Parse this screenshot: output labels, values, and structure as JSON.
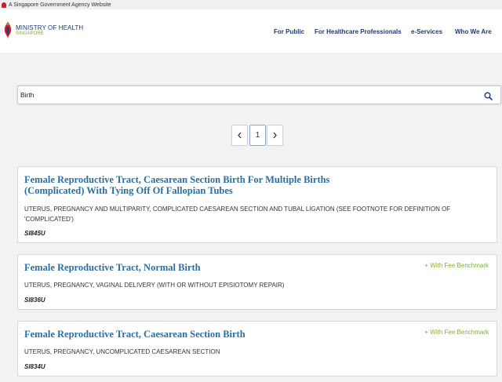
{
  "gov_banner": "A Singapore Government Agency Website",
  "logo": {
    "title": "MINISTRY OF HEALTH",
    "subtitle": "SINGAPORE"
  },
  "nav": {
    "items": [
      "For Public",
      "For Healthcare Professionals",
      "e-Services",
      "Who We Are"
    ]
  },
  "search": {
    "value": "Birth"
  },
  "pagination": {
    "prev": "‹",
    "current": "1",
    "next": "›"
  },
  "results": [
    {
      "title_line1": "Female Reproductive Tract, Caesarean Section Birth For Multiple Births",
      "title_line2": "(Complicated) With Tying Off Of Fallopian Tubes",
      "description_line1": "UTERUS, PREGNANCY AND MULTIPARITY, COMPLICATED CAESAREAN SECTION AND TUBAL LIGATION (SEE FOOTNOTE FOR DEFINITION OF",
      "description_line2": "'COMPLICATED')",
      "code": "SI845U",
      "badge": ""
    },
    {
      "title_line1": "Female Reproductive Tract, Normal Birth",
      "description_line1": "UTERUS, PREGNANCY, VAGINAL DELIVERY (WITH OR WITHOUT EPISIOTOMY REPAIR)",
      "code": "SI836U",
      "badge": "+ With Fee Benchmark"
    },
    {
      "title_line1": "Female Reproductive Tract, Caesarean Section Birth",
      "description_line1": "UTERUS, PREGNANCY, UNCOMPLICATED CAESAREAN SECTION",
      "code": "SI834U",
      "badge": "+ With Fee Benchmark"
    }
  ],
  "colors": {
    "brand_navy": "#1d3b74",
    "brand_green": "#7fb133",
    "title_blue": "#2e6e9e",
    "gov_red": "#d0202b"
  },
  "icons": [
    "lion-head-icon",
    "moh-logo-icon",
    "search-icon",
    "chevron-left-icon",
    "chevron-right-icon"
  ]
}
